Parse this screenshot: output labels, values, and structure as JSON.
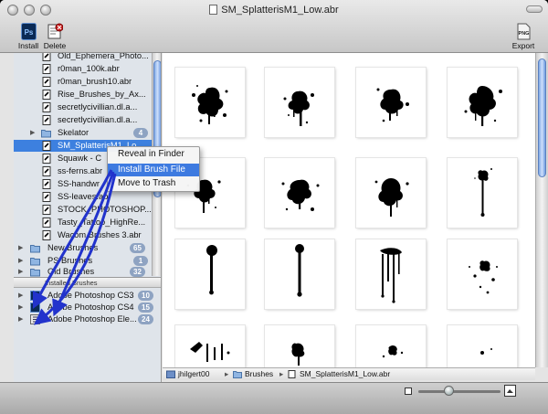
{
  "window": {
    "title": "SM_SplatterisM1_Low.abr"
  },
  "toolbar": {
    "install_label": "Install",
    "delete_label": "Delete",
    "export_label": "Export",
    "install_icon_text": "Ps",
    "export_icon_text": "PNG"
  },
  "sidebar": {
    "files": [
      {
        "label": "Old_Ephemera_Photo...",
        "badge": ""
      },
      {
        "label": "r0man_100k.abr",
        "badge": ""
      },
      {
        "label": "r0man_brush10.abr",
        "badge": ""
      },
      {
        "label": "Rise_Brushes_by_Ax...",
        "badge": ""
      },
      {
        "label": "secretlycivillian.dl.a...",
        "badge": ""
      },
      {
        "label": "secretlycivillian.dl.a...",
        "badge": ""
      }
    ],
    "folder_skelator": {
      "label": "Skelator",
      "badge": "4"
    },
    "selected": {
      "label": "SM_SplatterisM1_Lo"
    },
    "files2": [
      {
        "label": "Squawk - C"
      },
      {
        "label": "ss-ferns.abr"
      },
      {
        "label": "SS-handwr"
      },
      {
        "label": "SS-leaves.abr"
      },
      {
        "label": "STOCK_PHOTOSHOP..."
      },
      {
        "label": "Tasty_Tattoo_HighRe..."
      },
      {
        "label": "Wacom Brushes 3.abr"
      }
    ],
    "folders": [
      {
        "label": "New Brushes",
        "badge": "65"
      },
      {
        "label": "PS Brushes",
        "badge": "1"
      },
      {
        "label": "Old Brushes",
        "badge": "32"
      }
    ],
    "installed_header": "Installed Brushes",
    "installed": [
      {
        "label": "Adobe Photoshop CS3",
        "badge": "10"
      },
      {
        "label": "Adobe Photoshop CS4",
        "badge": "15"
      },
      {
        "label": "Adobe Photoshop Ele...",
        "badge": "24"
      }
    ]
  },
  "context_menu": {
    "items": [
      "Reveal in Finder",
      "Install Brush File",
      "Move to Trash"
    ],
    "highlighted_index": 1
  },
  "pathbar": {
    "segments": [
      "jhilgert00",
      "Brushes",
      "SM_SplatterisM1_Low.abr"
    ]
  },
  "colors": {
    "selection": "#3d80df",
    "badge": "#8ea3c2",
    "arrow": "#2233cc"
  },
  "zoom_slider_value": 0.35
}
